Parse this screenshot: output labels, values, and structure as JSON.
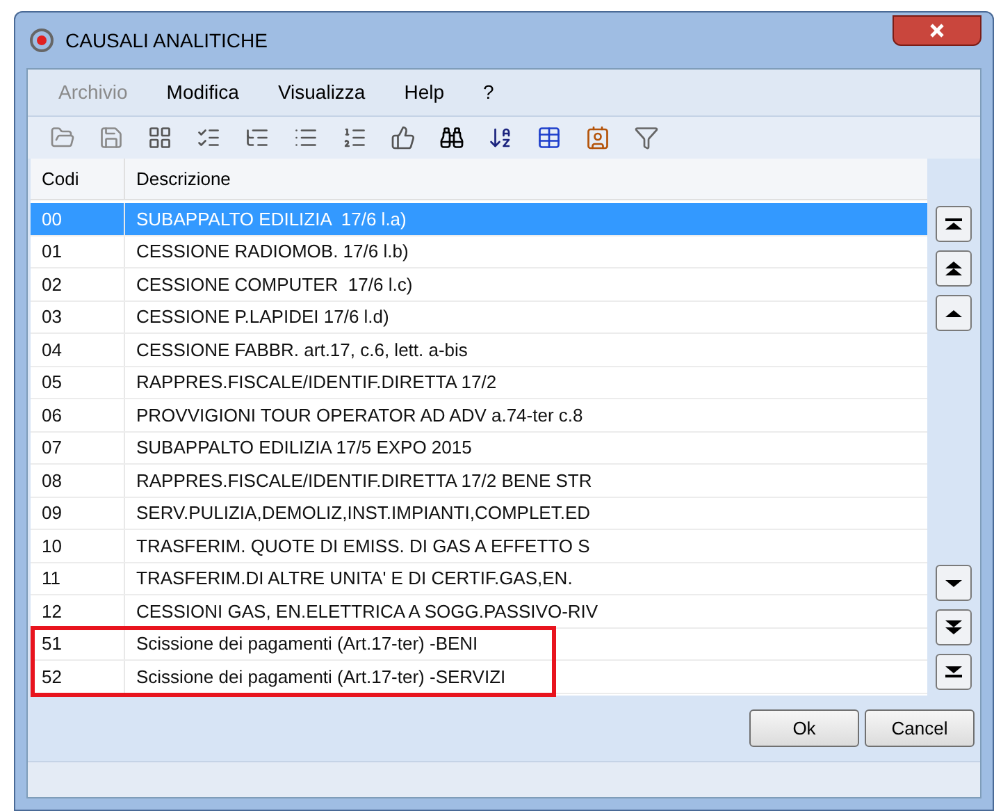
{
  "window": {
    "title": "CAUSALI ANALITICHE"
  },
  "menu": [
    {
      "label": "Archivio",
      "disabled": true
    },
    {
      "label": "Modifica",
      "disabled": false
    },
    {
      "label": "Visualizza",
      "disabled": false
    },
    {
      "label": "Help",
      "disabled": false
    },
    {
      "label": "?",
      "disabled": false
    }
  ],
  "table": {
    "columns": [
      "Codi",
      "Descrizione"
    ],
    "rows": [
      {
        "code": "00",
        "description": "SUBAPPALTO EDILIZIA  17/6 l.a)",
        "selected": true,
        "highlighted": false
      },
      {
        "code": "01",
        "description": "CESSIONE RADIOMOB. 17/6 l.b)",
        "selected": false,
        "highlighted": false
      },
      {
        "code": "02",
        "description": "CESSIONE COMPUTER  17/6 l.c)",
        "selected": false,
        "highlighted": false
      },
      {
        "code": "03",
        "description": "CESSIONE P.LAPIDEI 17/6 l.d)",
        "selected": false,
        "highlighted": false
      },
      {
        "code": "04",
        "description": "CESSIONE FABBR. art.17, c.6, lett. a-bis",
        "selected": false,
        "highlighted": false
      },
      {
        "code": "05",
        "description": "RAPPRES.FISCALE/IDENTIF.DIRETTA 17/2",
        "selected": false,
        "highlighted": false
      },
      {
        "code": "06",
        "description": "PROVVIGIONI TOUR OPERATOR AD ADV a.74-ter c.8",
        "selected": false,
        "highlighted": false
      },
      {
        "code": "07",
        "description": "SUBAPPALTO EDILIZIA 17/5 EXPO 2015",
        "selected": false,
        "highlighted": false
      },
      {
        "code": "08",
        "description": "RAPPRES.FISCALE/IDENTIF.DIRETTA 17/2 BENE STR",
        "selected": false,
        "highlighted": false
      },
      {
        "code": "09",
        "description": "SERV.PULIZIA,DEMOLIZ,INST.IMPIANTI,COMPLET.ED",
        "selected": false,
        "highlighted": false
      },
      {
        "code": "10",
        "description": "TRASFERIM. QUOTE DI EMISS. DI GAS A EFFETTO S",
        "selected": false,
        "highlighted": false
      },
      {
        "code": "11",
        "description": "TRASFERIM.DI ALTRE UNITA' E DI CERTIF.GAS,EN.",
        "selected": false,
        "highlighted": false
      },
      {
        "code": "12",
        "description": "CESSIONI GAS, EN.ELETTRICA A SOGG.PASSIVO-RIV",
        "selected": false,
        "highlighted": false
      },
      {
        "code": "51",
        "description": "Scissione dei pagamenti (Art.17-ter) -BENI",
        "selected": false,
        "highlighted": true
      },
      {
        "code": "52",
        "description": "Scissione dei pagamenti (Art.17-ter) -SERVIZI",
        "selected": false,
        "highlighted": true
      }
    ]
  },
  "buttons": [
    "Ok",
    "Cancel"
  ]
}
